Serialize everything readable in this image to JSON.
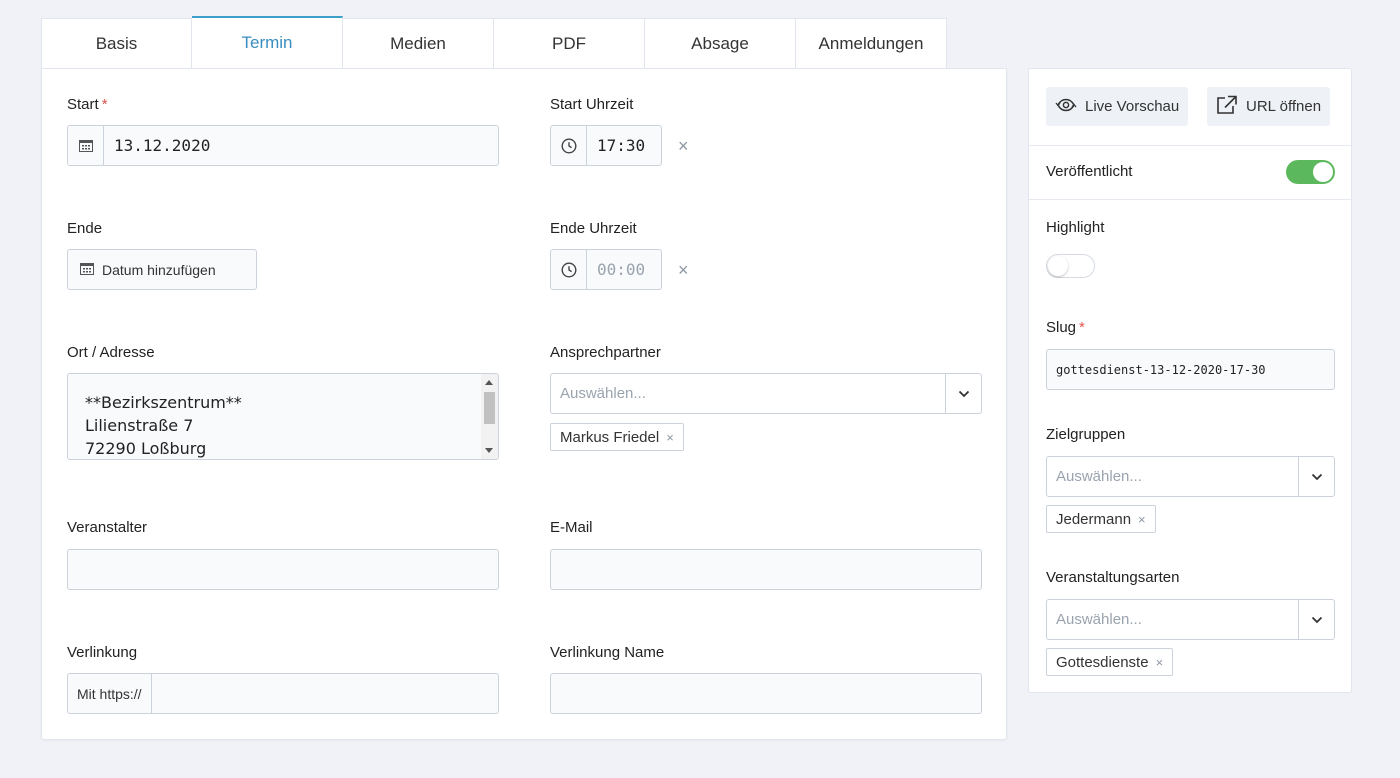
{
  "tabs": [
    {
      "label": "Basis",
      "active": false
    },
    {
      "label": "Termin",
      "active": true
    },
    {
      "label": "Medien",
      "active": false
    },
    {
      "label": "PDF",
      "active": false
    },
    {
      "label": "Absage",
      "active": false
    },
    {
      "label": "Anmeldungen",
      "active": false
    }
  ],
  "form": {
    "start": {
      "label": "Start",
      "required_mark": "*",
      "value": "13.12.2020"
    },
    "start_time": {
      "label": "Start Uhrzeit",
      "value": "17:30",
      "clear": "×"
    },
    "end": {
      "label": "Ende",
      "button_label": "Datum hinzufügen"
    },
    "end_time": {
      "label": "Ende Uhrzeit",
      "placeholder": "00:00",
      "clear": "×"
    },
    "address": {
      "label": "Ort / Adresse",
      "lines": [
        "**Bezirkszentrum**",
        "Lilienstraße 7",
        "72290 Loßburg"
      ]
    },
    "contact": {
      "label": "Ansprechpartner",
      "placeholder": "Auswählen...",
      "tags": [
        "Markus Friedel"
      ]
    },
    "organizer": {
      "label": "Veranstalter",
      "value": ""
    },
    "email": {
      "label": "E-Mail",
      "value": ""
    },
    "link": {
      "label": "Verlinkung",
      "prefix": "Mit https://",
      "value": ""
    },
    "link_name": {
      "label": "Verlinkung Name",
      "value": ""
    }
  },
  "sidebar": {
    "live_preview_label": "Live Vorschau",
    "open_url_label": "URL öffnen",
    "published": {
      "label": "Veröffentlicht",
      "on": true
    },
    "highlight": {
      "label": "Highlight",
      "on": false
    },
    "slug": {
      "label": "Slug",
      "required_mark": "*",
      "value": "gottesdienst-13-12-2020-17-30"
    },
    "target_groups": {
      "label": "Zielgruppen",
      "placeholder": "Auswählen...",
      "tags": [
        "Jedermann"
      ]
    },
    "event_types": {
      "label": "Veranstaltungsarten",
      "placeholder": "Auswählen...",
      "tags": [
        "Gottesdienste"
      ]
    }
  },
  "tag_remove": "×",
  "colors": {
    "accent": "#3a8ec0",
    "toggle_on": "#5cb85c",
    "required": "#e0524a"
  }
}
